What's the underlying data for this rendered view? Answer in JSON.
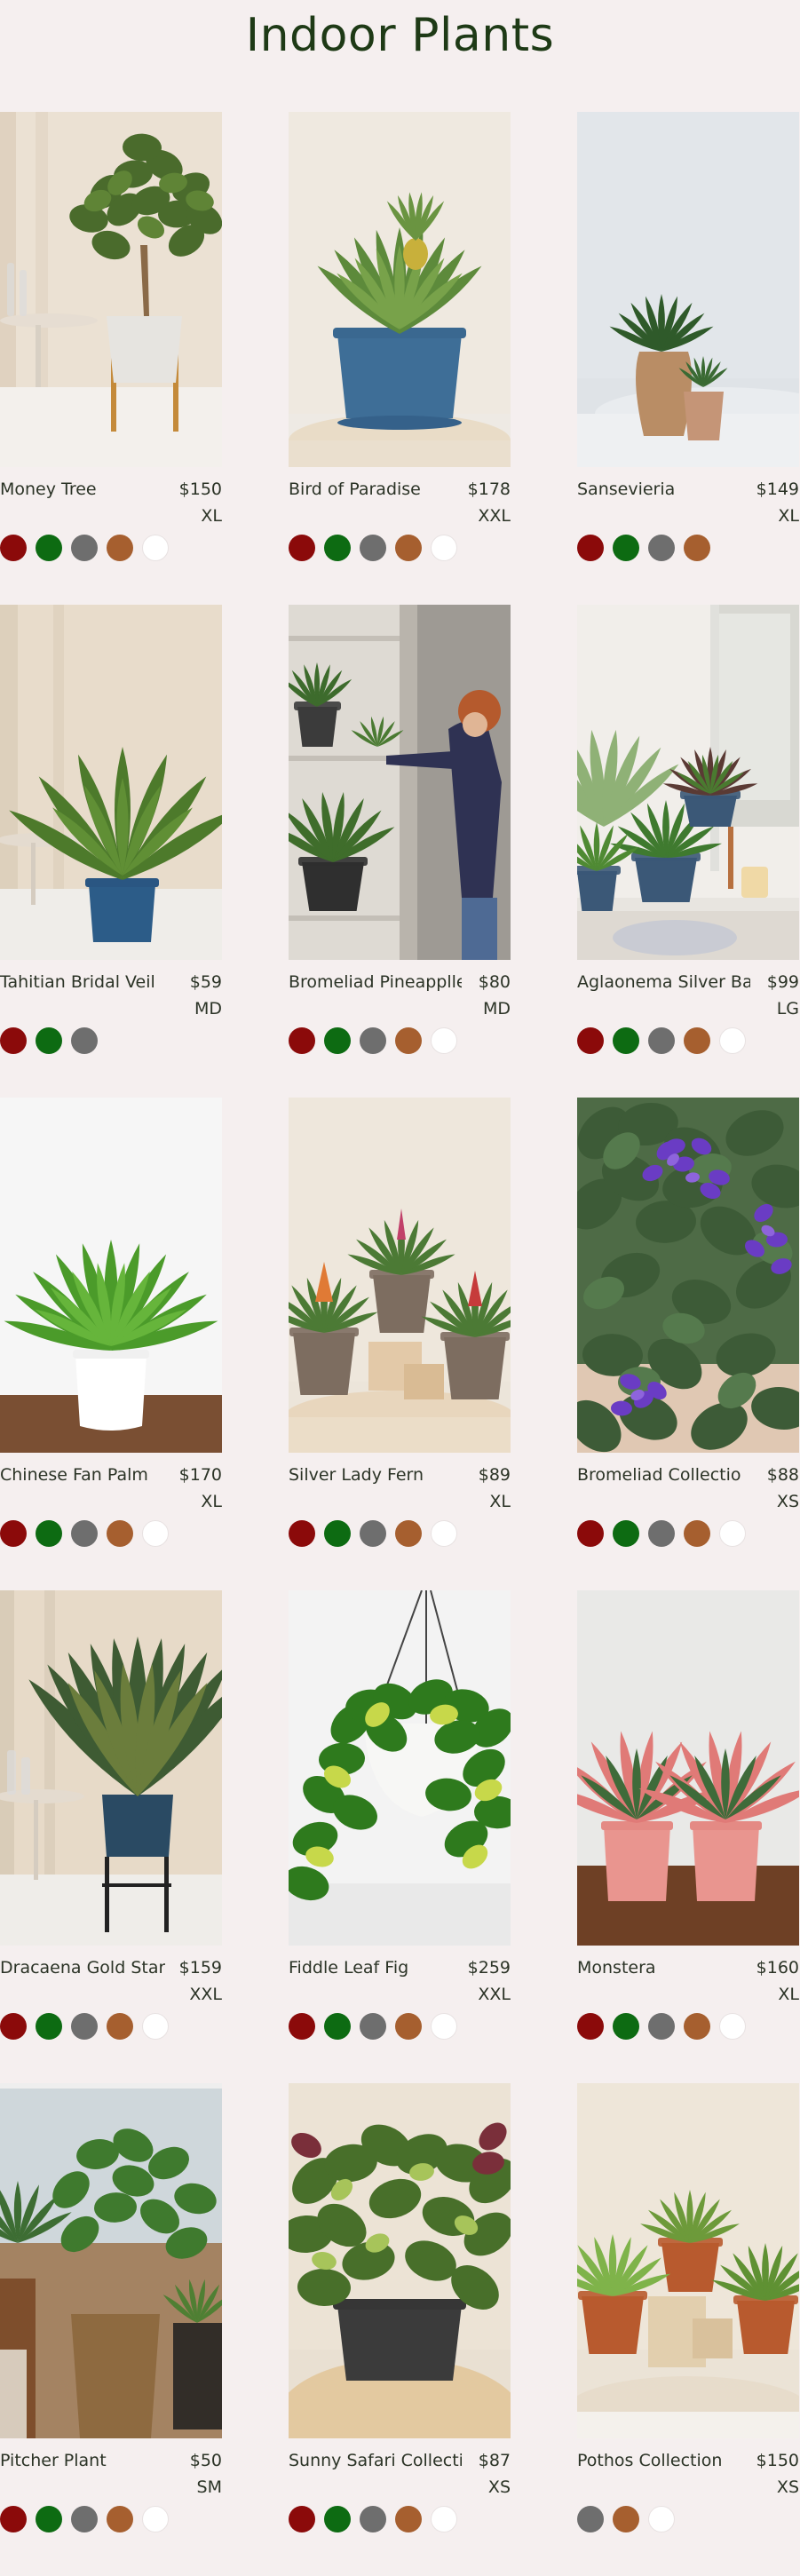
{
  "page": {
    "title": "Indoor Plants"
  },
  "swatch_colors": {
    "red": "#8b0a0a",
    "green": "#0d6b12",
    "gray": "#6e6e6e",
    "brown": "#a65f2f",
    "white": "#ffffff"
  },
  "products": [
    {
      "name": "Money Tree",
      "price": "$150",
      "size": "XL",
      "swatches": [
        "red",
        "green",
        "gray",
        "brown",
        "white"
      ],
      "scene": "money-tree"
    },
    {
      "name": "Bird of Paradise",
      "price": "$178",
      "size": "XXL",
      "swatches": [
        "red",
        "green",
        "gray",
        "brown",
        "white"
      ],
      "scene": "pineapple-blue-pot"
    },
    {
      "name": "Sansevieria",
      "price": "$149",
      "size": "XL",
      "swatches": [
        "red",
        "green",
        "gray",
        "brown"
      ],
      "scene": "wood-vases"
    },
    {
      "name": "Tahitian Bridal Veil",
      "price": "$59",
      "size": "MD",
      "swatches": [
        "red",
        "green",
        "gray"
      ],
      "scene": "banana-leaf-blue-pot"
    },
    {
      "name": "Bromeliad Pineapplle",
      "price": "$80",
      "size": "MD",
      "swatches": [
        "red",
        "green",
        "gray",
        "brown",
        "white"
      ],
      "scene": "woman-shelf"
    },
    {
      "name": "Aglaonema Silver Bay",
      "price": "$99",
      "size": "LG",
      "swatches": [
        "red",
        "green",
        "gray",
        "brown",
        "white"
      ],
      "scene": "bathroom-plants"
    },
    {
      "name": "Chinese Fan Palm",
      "price": "$170",
      "size": "XL",
      "swatches": [
        "red",
        "green",
        "gray",
        "brown",
        "white"
      ],
      "scene": "fern-white-pot"
    },
    {
      "name": "Silver Lady Fern",
      "price": "$89",
      "size": "XL",
      "swatches": [
        "red",
        "green",
        "gray",
        "brown",
        "white"
      ],
      "scene": "bromeliads"
    },
    {
      "name": "Bromeliad Collectio",
      "price": "$88",
      "size": "XS",
      "swatches": [
        "red",
        "green",
        "gray",
        "brown",
        "white"
      ],
      "scene": "african-violets"
    },
    {
      "name": "Dracaena Gold Star",
      "price": "$159",
      "size": "XXL",
      "swatches": [
        "red",
        "green",
        "gray",
        "brown",
        "white"
      ],
      "scene": "snake-plant"
    },
    {
      "name": "Fiddle Leaf Fig",
      "price": "$259",
      "size": "XXL",
      "swatches": [
        "red",
        "green",
        "gray",
        "brown",
        "white"
      ],
      "scene": "hanging-pothos"
    },
    {
      "name": "Monstera",
      "price": "$160",
      "size": "XL",
      "swatches": [
        "red",
        "green",
        "gray",
        "brown",
        "white"
      ],
      "scene": "pink-aglaonema"
    },
    {
      "name": "Pitcher Plant",
      "price": "$50",
      "size": "SM",
      "swatches": [
        "red",
        "green",
        "gray",
        "brown",
        "white"
      ],
      "scene": "living-room"
    },
    {
      "name": "Sunny Safari Collection",
      "price": "$87",
      "size": "XS",
      "swatches": [
        "red",
        "green",
        "gray",
        "brown",
        "white"
      ],
      "scene": "prayer-plant"
    },
    {
      "name": "Pothos Collection",
      "price": "$150",
      "size": "XS",
      "swatches": [
        "gray",
        "brown",
        "white"
      ],
      "scene": "terracotta-trio"
    }
  ]
}
